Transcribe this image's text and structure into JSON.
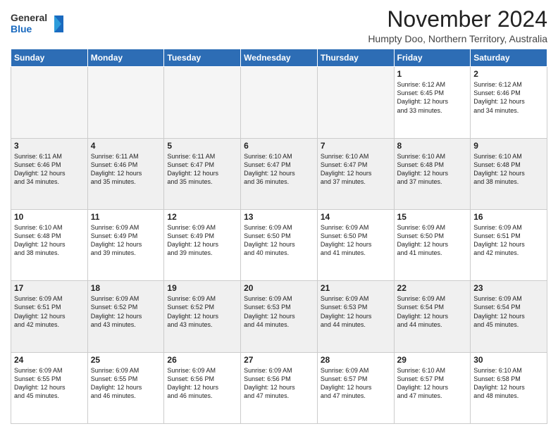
{
  "logo": {
    "line1": "General",
    "line2": "Blue"
  },
  "title": "November 2024",
  "location": "Humpty Doo, Northern Territory, Australia",
  "weekdays": [
    "Sunday",
    "Monday",
    "Tuesday",
    "Wednesday",
    "Thursday",
    "Friday",
    "Saturday"
  ],
  "weeks": [
    [
      {
        "day": "",
        "info": ""
      },
      {
        "day": "",
        "info": ""
      },
      {
        "day": "",
        "info": ""
      },
      {
        "day": "",
        "info": ""
      },
      {
        "day": "",
        "info": ""
      },
      {
        "day": "1",
        "info": "Sunrise: 6:12 AM\nSunset: 6:45 PM\nDaylight: 12 hours\nand 33 minutes."
      },
      {
        "day": "2",
        "info": "Sunrise: 6:12 AM\nSunset: 6:46 PM\nDaylight: 12 hours\nand 34 minutes."
      }
    ],
    [
      {
        "day": "3",
        "info": "Sunrise: 6:11 AM\nSunset: 6:46 PM\nDaylight: 12 hours\nand 34 minutes."
      },
      {
        "day": "4",
        "info": "Sunrise: 6:11 AM\nSunset: 6:46 PM\nDaylight: 12 hours\nand 35 minutes."
      },
      {
        "day": "5",
        "info": "Sunrise: 6:11 AM\nSunset: 6:47 PM\nDaylight: 12 hours\nand 35 minutes."
      },
      {
        "day": "6",
        "info": "Sunrise: 6:10 AM\nSunset: 6:47 PM\nDaylight: 12 hours\nand 36 minutes."
      },
      {
        "day": "7",
        "info": "Sunrise: 6:10 AM\nSunset: 6:47 PM\nDaylight: 12 hours\nand 37 minutes."
      },
      {
        "day": "8",
        "info": "Sunrise: 6:10 AM\nSunset: 6:48 PM\nDaylight: 12 hours\nand 37 minutes."
      },
      {
        "day": "9",
        "info": "Sunrise: 6:10 AM\nSunset: 6:48 PM\nDaylight: 12 hours\nand 38 minutes."
      }
    ],
    [
      {
        "day": "10",
        "info": "Sunrise: 6:10 AM\nSunset: 6:48 PM\nDaylight: 12 hours\nand 38 minutes."
      },
      {
        "day": "11",
        "info": "Sunrise: 6:09 AM\nSunset: 6:49 PM\nDaylight: 12 hours\nand 39 minutes."
      },
      {
        "day": "12",
        "info": "Sunrise: 6:09 AM\nSunset: 6:49 PM\nDaylight: 12 hours\nand 39 minutes."
      },
      {
        "day": "13",
        "info": "Sunrise: 6:09 AM\nSunset: 6:50 PM\nDaylight: 12 hours\nand 40 minutes."
      },
      {
        "day": "14",
        "info": "Sunrise: 6:09 AM\nSunset: 6:50 PM\nDaylight: 12 hours\nand 41 minutes."
      },
      {
        "day": "15",
        "info": "Sunrise: 6:09 AM\nSunset: 6:50 PM\nDaylight: 12 hours\nand 41 minutes."
      },
      {
        "day": "16",
        "info": "Sunrise: 6:09 AM\nSunset: 6:51 PM\nDaylight: 12 hours\nand 42 minutes."
      }
    ],
    [
      {
        "day": "17",
        "info": "Sunrise: 6:09 AM\nSunset: 6:51 PM\nDaylight: 12 hours\nand 42 minutes."
      },
      {
        "day": "18",
        "info": "Sunrise: 6:09 AM\nSunset: 6:52 PM\nDaylight: 12 hours\nand 43 minutes."
      },
      {
        "day": "19",
        "info": "Sunrise: 6:09 AM\nSunset: 6:52 PM\nDaylight: 12 hours\nand 43 minutes."
      },
      {
        "day": "20",
        "info": "Sunrise: 6:09 AM\nSunset: 6:53 PM\nDaylight: 12 hours\nand 44 minutes."
      },
      {
        "day": "21",
        "info": "Sunrise: 6:09 AM\nSunset: 6:53 PM\nDaylight: 12 hours\nand 44 minutes."
      },
      {
        "day": "22",
        "info": "Sunrise: 6:09 AM\nSunset: 6:54 PM\nDaylight: 12 hours\nand 44 minutes."
      },
      {
        "day": "23",
        "info": "Sunrise: 6:09 AM\nSunset: 6:54 PM\nDaylight: 12 hours\nand 45 minutes."
      }
    ],
    [
      {
        "day": "24",
        "info": "Sunrise: 6:09 AM\nSunset: 6:55 PM\nDaylight: 12 hours\nand 45 minutes."
      },
      {
        "day": "25",
        "info": "Sunrise: 6:09 AM\nSunset: 6:55 PM\nDaylight: 12 hours\nand 46 minutes."
      },
      {
        "day": "26",
        "info": "Sunrise: 6:09 AM\nSunset: 6:56 PM\nDaylight: 12 hours\nand 46 minutes."
      },
      {
        "day": "27",
        "info": "Sunrise: 6:09 AM\nSunset: 6:56 PM\nDaylight: 12 hours\nand 47 minutes."
      },
      {
        "day": "28",
        "info": "Sunrise: 6:09 AM\nSunset: 6:57 PM\nDaylight: 12 hours\nand 47 minutes."
      },
      {
        "day": "29",
        "info": "Sunrise: 6:10 AM\nSunset: 6:57 PM\nDaylight: 12 hours\nand 47 minutes."
      },
      {
        "day": "30",
        "info": "Sunrise: 6:10 AM\nSunset: 6:58 PM\nDaylight: 12 hours\nand 48 minutes."
      }
    ]
  ]
}
